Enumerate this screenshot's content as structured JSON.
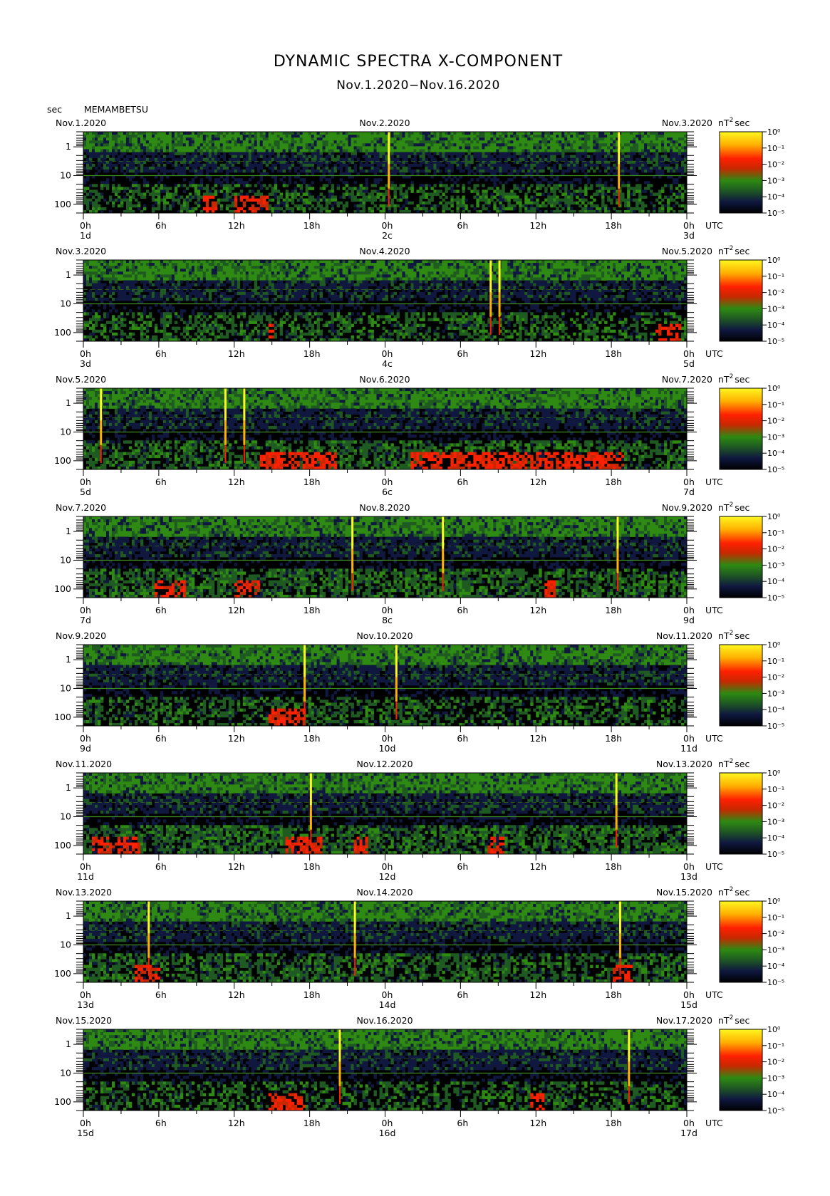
{
  "title": "DYNAMIC SPECTRA X-COMPONENT",
  "subtitle": "Nov.1.2020−Nov.16.2020",
  "y_unit_label": "sec",
  "station": "MEMAMBETSU",
  "colorbar_unit": "nT",
  "colorbar_unit_exp": "2",
  "colorbar_unit_tail": "sec",
  "colorbar_tick_labels": [
    "10⁰",
    "10⁻¹",
    "10⁻²",
    "10⁻³",
    "10⁻⁴",
    "10⁻⁵"
  ],
  "colorbar_colors": [
    "#fff820",
    "#ffb000",
    "#ff2000",
    "#c82800",
    "#2e8a12",
    "#1f5a22",
    "#101840",
    "#000000"
  ],
  "x_tick_labels": [
    "0h",
    "6h",
    "12h",
    "18h",
    "0h",
    "6h",
    "12h",
    "18h",
    "0h"
  ],
  "utc_label": "UTC",
  "chart_data": {
    "type": "heatmap",
    "title": "DYNAMIC SPECTRA X-COMPONENT",
    "ylabel": "sec",
    "y_scale": "log",
    "ylim": [
      0.3,
      200
    ],
    "y_ticks": [
      1,
      10,
      100
    ],
    "y_tick_labels": [
      "1",
      "10",
      "100"
    ],
    "x_hours_per_panel": 48,
    "x_tick_hours": [
      0,
      6,
      12,
      18,
      24,
      30,
      36,
      42,
      48
    ],
    "colorbar": {
      "scale": "log",
      "range": [
        1e-05,
        1
      ],
      "unit": "nT²sec"
    },
    "panels": [
      {
        "date_left": "Nov.1.2020",
        "date_mid": "Nov.2.2020",
        "date_right": "Nov.3.2020",
        "day_left": "1d",
        "day_mid": "2c",
        "day_right": "3d",
        "spikes_hours": [
          24.3,
          42.6
        ],
        "activity_level": 0.55,
        "hot_hours": [
          [
            9.5,
            10.5
          ],
          [
            12,
            14.5
          ]
        ]
      },
      {
        "date_left": "Nov.3.2020",
        "date_mid": "Nov.4.2020",
        "date_right": "Nov.5.2020",
        "day_left": "3d",
        "day_mid": "4c",
        "day_right": "5d",
        "spikes_hours": [
          32.4,
          33.1
        ],
        "activity_level": 0.5,
        "hot_hours": [
          [
            14.5,
            15
          ],
          [
            45.5,
            47.5
          ]
        ]
      },
      {
        "date_left": "Nov.5.2020",
        "date_mid": "Nov.6.2020",
        "date_right": "Nov.7.2020",
        "day_left": "5d",
        "day_mid": "6c",
        "day_right": "7d",
        "spikes_hours": [
          1.4,
          11.3,
          12.8
        ],
        "activity_level": 0.62,
        "hot_hours": [
          [
            14,
            20
          ],
          [
            26,
            43
          ]
        ]
      },
      {
        "date_left": "Nov.7.2020",
        "date_mid": "Nov.8.2020",
        "date_right": "Nov.9.2020",
        "day_left": "7d",
        "day_mid": "8c",
        "day_right": "9d",
        "spikes_hours": [
          21.4,
          28.6,
          42.5
        ],
        "activity_level": 0.66,
        "hot_hours": [
          [
            5.5,
            8
          ],
          [
            12,
            14
          ],
          [
            36.5,
            37.5
          ]
        ]
      },
      {
        "date_left": "Nov.9.2020",
        "date_mid": "Nov.10.2020",
        "date_right": "Nov.11.2020",
        "day_left": "9d",
        "day_mid": "10d",
        "day_right": "11d",
        "spikes_hours": [
          17.6,
          24.9
        ],
        "activity_level": 0.5,
        "hot_hours": [
          [
            14.5,
            17.5
          ]
        ]
      },
      {
        "date_left": "Nov.11.2020",
        "date_mid": "Nov.12.2020",
        "date_right": "Nov.13.2020",
        "day_left": "11d",
        "day_mid": "12d",
        "day_right": "13d",
        "spikes_hours": [
          18.1,
          42.4
        ],
        "activity_level": 0.7,
        "hot_hours": [
          [
            0.5,
            4.5
          ],
          [
            16,
            19
          ],
          [
            21.5,
            22.5
          ],
          [
            32,
            33.5
          ]
        ]
      },
      {
        "date_left": "Nov.13.2020",
        "date_mid": "Nov.14.2020",
        "date_right": "Nov.15.2020",
        "day_left": "13d",
        "day_mid": "14d",
        "day_right": "15d",
        "spikes_hours": [
          5.2,
          21.6,
          42.7
        ],
        "activity_level": 0.6,
        "hot_hours": [
          [
            4,
            6
          ],
          [
            42,
            43.5
          ]
        ]
      },
      {
        "date_left": "Nov.15.2020",
        "date_mid": "Nov.16.2020",
        "date_right": "Nov.17.2020",
        "day_left": "15d",
        "day_mid": "16d",
        "day_right": "17d",
        "spikes_hours": [
          20.4,
          43.4
        ],
        "activity_level": 0.48,
        "hot_hours": [
          [
            14.5,
            17.5
          ],
          [
            35.5,
            36.5
          ]
        ]
      }
    ]
  }
}
